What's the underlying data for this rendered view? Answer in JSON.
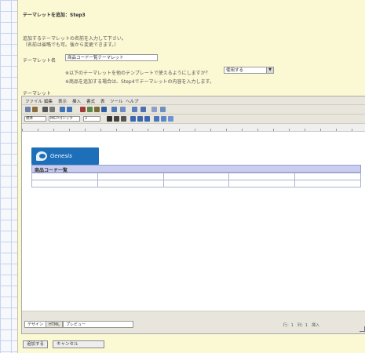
{
  "form": {
    "title": "テーマレットを追加：Step3",
    "desc_line1": "追加するテーマレットの名前を入力して下さい。",
    "desc_line2": "（名前は省略でも可。後から変更できます。）",
    "name_label": "テーマレット名",
    "name_value": "商品コード一覧テーマレット",
    "note1": "※以下のテーマレットを他のテンプレートで使えるようにしますか？",
    "select_value": "使用する",
    "note2": "※商品を追加する場合は、Step4でテーマレットの内容を入力します。",
    "content_label": "テーマレット"
  },
  "editor": {
    "menu": [
      "ファイル",
      "編集",
      "表示",
      "挿入",
      "書式",
      "表",
      "ツール",
      "ヘルプ"
    ],
    "style_combo": "標準",
    "font_combo": "MS Pゴシック",
    "size_combo": "3",
    "logo_text": "Genesis",
    "table_title": "商品コード一覧",
    "columns": 5,
    "rows": 2,
    "tabs": [
      "デザイン",
      "HTML",
      "プレビュー"
    ],
    "status": "行：1　列：1　挿入"
  },
  "buttons": {
    "save": "追加する",
    "cancel": "キャンセル"
  },
  "colors": {
    "panel": "#fbf8d4",
    "logo": "#1d6fb9",
    "table_header": "#c9cdf0"
  }
}
